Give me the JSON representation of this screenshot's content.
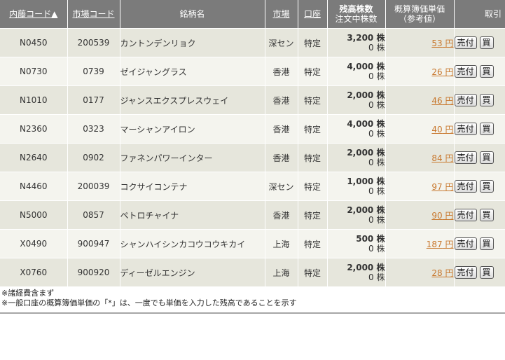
{
  "headers": {
    "internal_code": "内藤コード▲",
    "market_code": "市場コード",
    "name": "銘柄名",
    "market": "市場",
    "account": "口座",
    "balance_top": "残高株数",
    "balance_bottom": "注文中株数",
    "price_top": "概算簿価単価",
    "price_bottom": "（参考値）",
    "trade": "取引"
  },
  "buttons": {
    "sell": "売付",
    "buy": "買"
  },
  "rows": [
    {
      "code": "N0450",
      "market_code": "200539",
      "name": "カントンデンリョク",
      "market": "深セン",
      "account": "特定",
      "qty": "3,200",
      "unit": "株",
      "ordered": "0",
      "price": "53",
      "yen": "円"
    },
    {
      "code": "N0730",
      "market_code": "0739",
      "name": "ゼイジャングラス",
      "market": "香港",
      "account": "特定",
      "qty": "4,000",
      "unit": "株",
      "ordered": "0",
      "price": "26",
      "yen": "円"
    },
    {
      "code": "N1010",
      "market_code": "0177",
      "name": "ジャンスエクスプレスウェイ",
      "market": "香港",
      "account": "特定",
      "qty": "2,000",
      "unit": "株",
      "ordered": "0",
      "price": "46",
      "yen": "円"
    },
    {
      "code": "N2360",
      "market_code": "0323",
      "name": "マーシャンアイロン",
      "market": "香港",
      "account": "特定",
      "qty": "4,000",
      "unit": "株",
      "ordered": "0",
      "price": "40",
      "yen": "円"
    },
    {
      "code": "N2640",
      "market_code": "0902",
      "name": "ファネンパワーインター",
      "market": "香港",
      "account": "特定",
      "qty": "2,000",
      "unit": "株",
      "ordered": "0",
      "price": "84",
      "yen": "円"
    },
    {
      "code": "N4460",
      "market_code": "200039",
      "name": "コクサイコンテナ",
      "market": "深セン",
      "account": "特定",
      "qty": "1,000",
      "unit": "株",
      "ordered": "0",
      "price": "97",
      "yen": "円"
    },
    {
      "code": "N5000",
      "market_code": "0857",
      "name": "ペトロチャイナ",
      "market": "香港",
      "account": "特定",
      "qty": "2,000",
      "unit": "株",
      "ordered": "0",
      "price": "90",
      "yen": "円"
    },
    {
      "code": "X0490",
      "market_code": "900947",
      "name": "シャンハイシンカコウコウキカイ",
      "market": "上海",
      "account": "特定",
      "qty": "500",
      "unit": "株",
      "ordered": "0",
      "price": "187",
      "yen": "円"
    },
    {
      "code": "X0760",
      "market_code": "900920",
      "name": "ディーゼルエンジン",
      "market": "上海",
      "account": "特定",
      "qty": "2,000",
      "unit": "株",
      "ordered": "0",
      "price": "28",
      "yen": "円"
    }
  ],
  "notes": {
    "line1": "※諸経費含まず",
    "line2": "※一般口座の概算簿価単価の「*」は、一度でも単価を入力した残高であることを示す"
  }
}
